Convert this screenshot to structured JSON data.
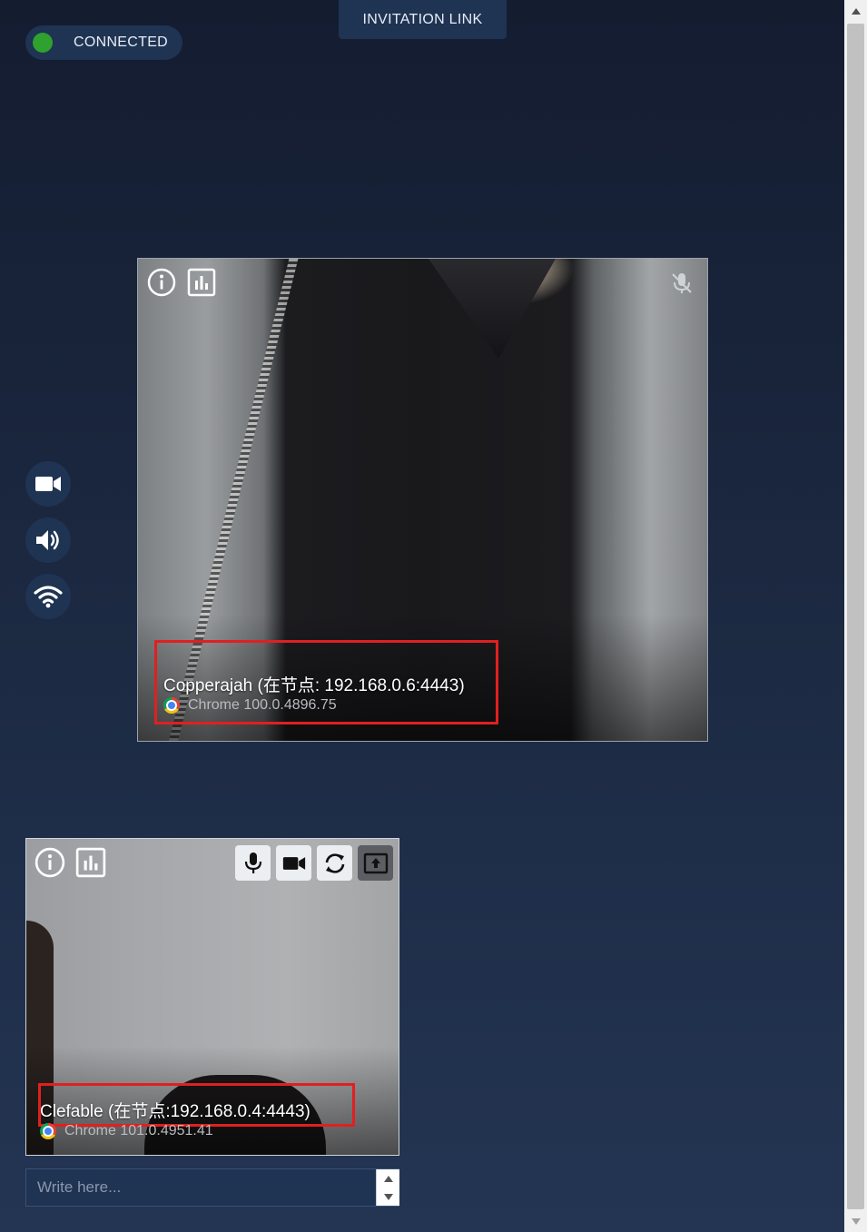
{
  "status": {
    "label": "CONNECTED",
    "color": "#2ea12e"
  },
  "header": {
    "invite_label": "INVITATION LINK"
  },
  "side_controls": [
    {
      "icon": "video-camera-icon"
    },
    {
      "icon": "speaker-icon"
    },
    {
      "icon": "wifi-icon"
    }
  ],
  "remote_peer": {
    "name": "Copperajah (在节点: 192.168.0.6:4443)",
    "browser": "Chrome 100.0.4896.75",
    "icons": [
      "info-icon",
      "stats-icon",
      "mic-muted-icon"
    ]
  },
  "local_peer": {
    "name": "Clefable (在节点:192.168.0.4:4443)",
    "browser": "Chrome 101.0.4951.41",
    "icons": [
      "info-icon",
      "stats-icon"
    ],
    "controls": [
      "microphone-icon",
      "video-camera-icon",
      "switch-camera-icon",
      "screen-share-icon"
    ]
  },
  "chat": {
    "placeholder": "Write here..."
  },
  "highlight_color": "#e02020"
}
